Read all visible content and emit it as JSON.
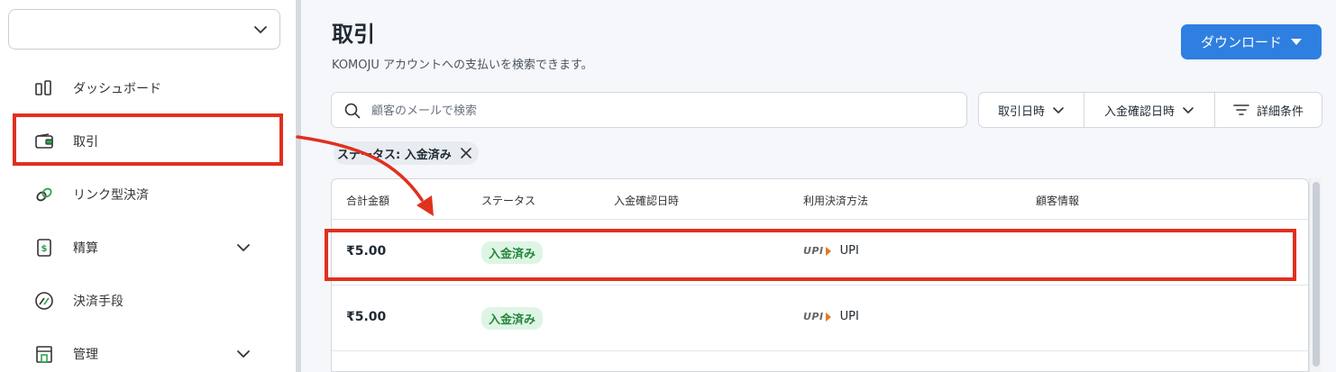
{
  "sidebar": {
    "account_select_value": "",
    "items": [
      {
        "label": "ダッシュボード",
        "icon": "dashboard-icon"
      },
      {
        "label": "取引",
        "icon": "wallet-icon"
      },
      {
        "label": "リンク型決済",
        "icon": "link-icon"
      },
      {
        "label": "精算",
        "icon": "settlement-icon"
      },
      {
        "label": "決済手段",
        "icon": "payment-methods-icon"
      },
      {
        "label": "管理",
        "icon": "store-icon"
      }
    ]
  },
  "header": {
    "title": "取引",
    "subtitle": "KOMOJU アカウントへの支払いを検索できます。",
    "download_label": "ダウンロード"
  },
  "search": {
    "placeholder": "顧客のメールで検索",
    "value": ""
  },
  "filters": {
    "transaction_date": "取引日時",
    "captured_date": "入金確認日時",
    "advanced": "詳細条件"
  },
  "active_filter": {
    "label": "ステータス: 入金済み"
  },
  "table": {
    "columns": [
      "合計金額",
      "ステータス",
      "入金確認日時",
      "利用決済方法",
      "顧客情報"
    ],
    "rows": [
      {
        "amount": "₹5.00",
        "status": "入金済み",
        "captured_at": "",
        "method_logo": "UPI",
        "method": "UPI",
        "customer": ""
      },
      {
        "amount": "₹5.00",
        "status": "入金済み",
        "captured_at": "",
        "method_logo": "UPI",
        "method": "UPI",
        "customer": ""
      }
    ]
  },
  "colors": {
    "primary": "#2f7fe0",
    "status_paid_bg": "#dff5e4",
    "status_paid_text": "#23863e",
    "annotation": "#e0301e"
  }
}
